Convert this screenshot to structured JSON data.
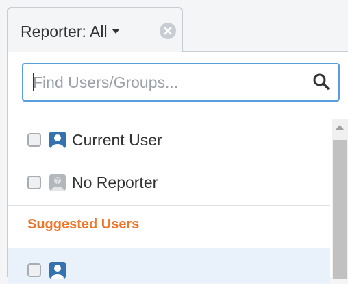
{
  "filter": {
    "label": "Reporter: All"
  },
  "search": {
    "placeholder": "Find Users/Groups...",
    "value": ""
  },
  "options": [
    {
      "label": "Current User",
      "avatar": "user-avatar-icon",
      "checked": false
    },
    {
      "label": "No Reporter",
      "avatar": "unknown-user-avatar-icon",
      "checked": false
    }
  ],
  "suggested": {
    "heading": "Suggested Users",
    "items": [
      {
        "label": "",
        "avatar": "user-avatar-icon",
        "checked": false
      }
    ]
  },
  "colors": {
    "accent": "#5b9ee0",
    "heading": "#f0762c",
    "avatar_blue": "#3572b0",
    "avatar_gray": "#b3b8bd",
    "highlight": "#e9f1fb"
  }
}
